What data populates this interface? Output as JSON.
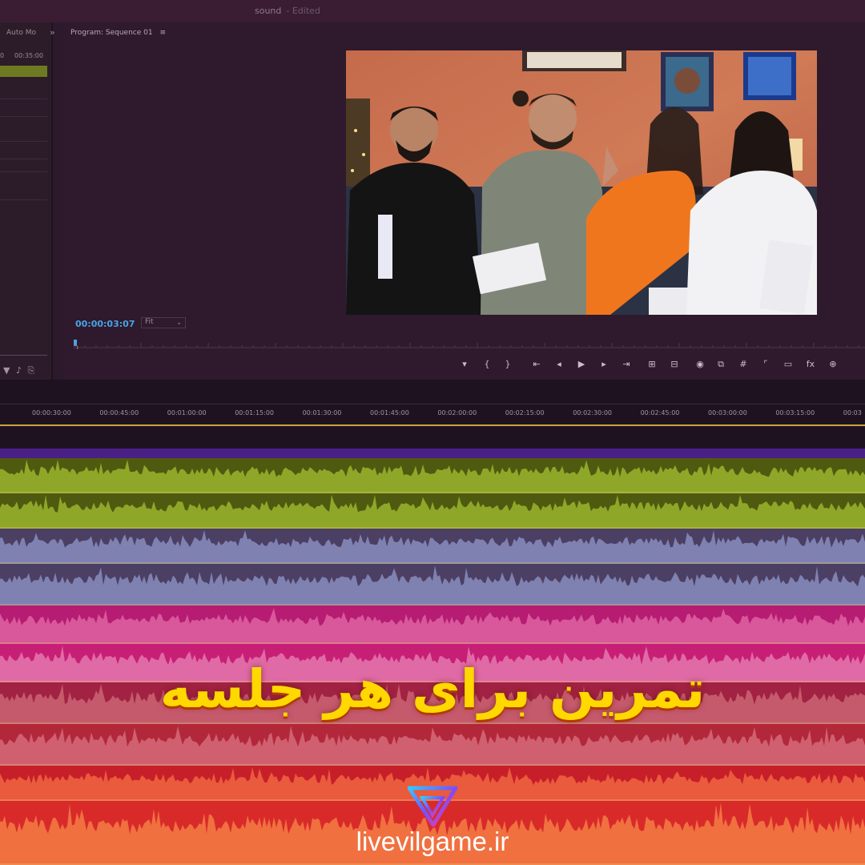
{
  "window": {
    "title": "sound",
    "status": "- Edited"
  },
  "left_panel": {
    "tab_label": "Auto Mo",
    "time_left": "0",
    "time_right": "00:35:00"
  },
  "program_monitor": {
    "title": "Program: Sequence 01",
    "timecode": "00:00:03:07",
    "zoom_value": "Fit"
  },
  "transport_icons": [
    "marker-icon",
    "mark-in-icon",
    "mark-out-icon",
    "go-to-in-icon",
    "step-back-icon",
    "play-icon",
    "step-forward-icon",
    "go-to-out-icon",
    "insert-icon",
    "overwrite-icon",
    "export-frame-icon",
    "compare-icon",
    "grid-icon",
    "safe-margins-icon",
    "comparison-view-icon",
    "fx-icon",
    "button-editor-icon"
  ],
  "timeline": {
    "ticks": [
      "00:00:30:00",
      "00:00:45:00",
      "00:01:00:00",
      "00:01:15:00",
      "00:01:30:00",
      "00:01:45:00",
      "00:02:00:00",
      "00:02:15:00",
      "00:02:30:00",
      "00:02:45:00",
      "00:03:00:00",
      "00:03:15:00",
      "00:03"
    ]
  },
  "audio_tracks": [
    {
      "name": "track-1a",
      "bg": "#4f5a10",
      "wave": "#8ea728"
    },
    {
      "name": "track-1b",
      "bg": "#4f5a10",
      "wave": "#8ea728"
    },
    {
      "name": "track-2a",
      "bg": "#4b3f63",
      "wave": "#7f81b0"
    },
    {
      "name": "track-2b",
      "bg": "#4b3f63",
      "wave": "#7f81b0"
    },
    {
      "name": "track-3a",
      "bg": "#b61c72",
      "wave": "#d8589b"
    },
    {
      "name": "track-3b",
      "bg": "#c81f76",
      "wave": "#e06aa5"
    },
    {
      "name": "track-4a",
      "bg": "#a12242",
      "wave": "#c55a6c"
    },
    {
      "name": "track-4b",
      "bg": "#b2283a",
      "wave": "#d06070"
    },
    {
      "name": "track-5a",
      "bg": "#c71f2a",
      "wave": "#ea5a3c"
    },
    {
      "name": "track-5b",
      "bg": "#d92a2a",
      "wave": "#f07040"
    }
  ],
  "headline": "تمرین برای هر جلسه",
  "brand": {
    "site": "livevilgame.ir",
    "accent": "#ffd800"
  }
}
